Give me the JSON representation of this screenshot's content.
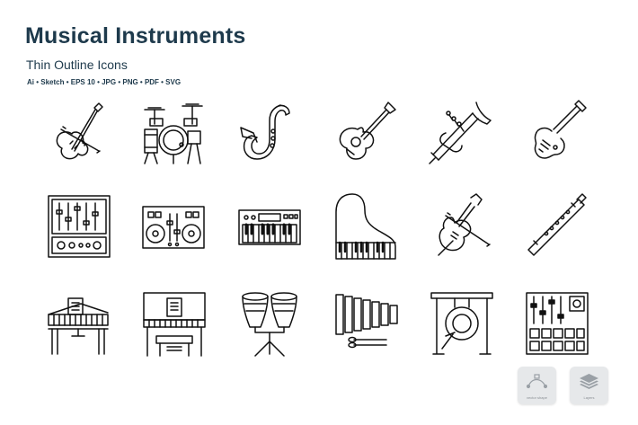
{
  "header": {
    "title": "Musical Instruments",
    "subtitle": "Thin Outline Icons",
    "formats": "Ai • Sketch • EPS 10 • JPG • PNG • PDF • SVG"
  },
  "colors": {
    "ink": "#111111",
    "title": "#1e3a4c",
    "badge_bg": "#e6e8ea",
    "badge_text": "#8a8f94"
  },
  "icons": [
    "violin-icon",
    "drum-kit-icon",
    "saxophone-icon",
    "acoustic-guitar-icon",
    "trumpet-icon",
    "electric-guitar-icon",
    "mixing-console-icon",
    "dj-controller-icon",
    "synthesizer-icon",
    "grand-piano-top-icon",
    "cello-icon",
    "flute-icon",
    "grand-piano-icon",
    "upright-piano-icon",
    "conga-drums-icon",
    "xylophone-icon",
    "gong-icon",
    "drum-pad-controller-icon"
  ],
  "badges": [
    {
      "icon": "vector-shape-icon",
      "label": "vector shape"
    },
    {
      "icon": "layers-icon",
      "label": "Layers"
    }
  ]
}
